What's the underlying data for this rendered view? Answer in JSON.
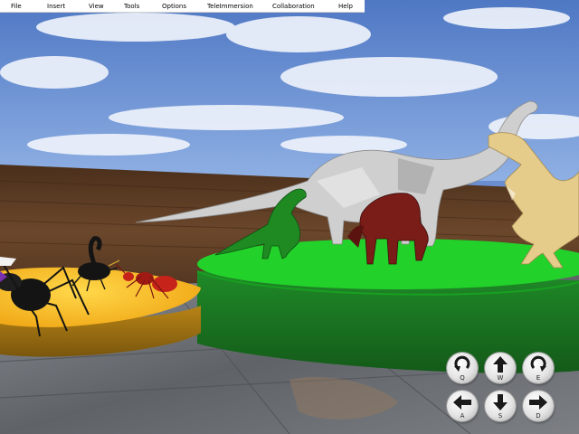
{
  "menu": {
    "items": [
      {
        "label": "File"
      },
      {
        "label": "Insert"
      },
      {
        "label": "View"
      },
      {
        "label": "Tools"
      },
      {
        "label": "Options"
      },
      {
        "label": "TeleImmersion"
      },
      {
        "label": "Collaboration"
      },
      {
        "label": "Help"
      }
    ]
  },
  "nav": {
    "buttons": [
      {
        "key": "Q",
        "icon": "rotate-left-icon"
      },
      {
        "key": "W",
        "icon": "arrow-up-icon"
      },
      {
        "key": "E",
        "icon": "rotate-right-icon"
      },
      {
        "key": "A",
        "icon": "arrow-left-icon"
      },
      {
        "key": "S",
        "icon": "arrow-down-icon"
      },
      {
        "key": "D",
        "icon": "arrow-right-icon"
      }
    ]
  },
  "colors": {
    "sky": "#5f86cf",
    "wall": "#5b3a22",
    "floor": "#6f7276",
    "green_platform_top": "#22d12a",
    "green_platform_side": "#1c7a24",
    "yellow_platform_top": "#f2b51c",
    "yellow_platform_side": "#a97a14",
    "sauropod": "#c8c8c8",
    "green_dino": "#1f8a22",
    "red_dino": "#7a1c17",
    "tan_dino": "#e6cc8a",
    "ant": "#c6231a",
    "spider": "#141414"
  }
}
